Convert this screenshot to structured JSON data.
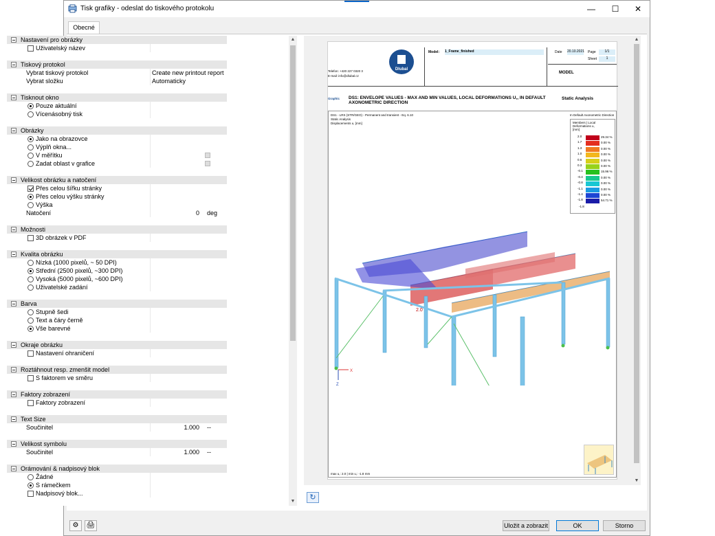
{
  "window": {
    "title": "Tisk grafiky - odeslat do tiskového protokolu"
  },
  "tabs": [
    {
      "label": "Obecné"
    }
  ],
  "tree": {
    "image_settings": {
      "title": "Nastavení pro obrázky",
      "user_name": "Uživatelský název"
    },
    "print_protocol": {
      "title": "Tiskový protokol",
      "select_protocol": "Vybrat tiskový protokol",
      "select_protocol_value": "Create new printout report",
      "select_folder": "Vybrat složku",
      "select_folder_value": "Automaticky"
    },
    "print_window": {
      "title": "Tisknout okno",
      "current_only": "Pouze aktuální",
      "multiple": "Vícenásobný tisk"
    },
    "images": {
      "title": "Obrázky",
      "as_on_screen": "Jako na obrazovce",
      "window_fill": "Výplň okna...",
      "to_scale": "V měřítku",
      "define_area": "Zadat oblast v grafice"
    },
    "size_rotation": {
      "title": "Velikost obrázku a natočení",
      "full_width": "Přes celou šířku stránky",
      "full_height": "Přes celou výšku stránky",
      "height": "Výška",
      "rotation": "Natočení",
      "rotation_value": "0",
      "rotation_unit": "deg"
    },
    "options": {
      "title": "Možnosti",
      "pdf3d": "3D obrázek v PDF"
    },
    "quality": {
      "title": "Kvalita obrázku",
      "low": "Nízká (1000 pixelů, ~ 50 DPI)",
      "medium": "Střední (2500 pixelů, ~300 DPI)",
      "high": "Vysoká (5000 pixelů, ~600 DPI)",
      "user": "Uživatelské zadání"
    },
    "color": {
      "title": "Barva",
      "grayscale": "Stupně šedi",
      "black_text": "Text a čáry černě",
      "all_color": "Vše barevné"
    },
    "margins": {
      "title": "Okraje obrázku",
      "set_margins": "Nastavení ohraničení"
    },
    "stretch": {
      "title": "Roztáhnout resp. zmenšit model",
      "with_factor": "S faktorem ve směru"
    },
    "display_factors": {
      "title": "Faktory zobrazení",
      "factors": "Faktory zobrazení"
    },
    "text_size": {
      "title": "Text Size",
      "factor": "Součinitel",
      "value": "1.000",
      "unit": "--"
    },
    "symbol_size": {
      "title": "Velikost symbolu",
      "factor": "Součinitel",
      "value": "1.000",
      "unit": "--"
    },
    "frame": {
      "title": "Orámování & nadpisový blok",
      "none": "Žádné",
      "with_frame": "S rámečkem",
      "title_block": "Nadpisový blok..."
    }
  },
  "preview": {
    "logo_text": "Dlubal",
    "model_label": "Model:",
    "model_value": "1_Frame_finished",
    "date_label": "Date",
    "date_value": "20.10.2021",
    "page_label": "Page",
    "page_value": "1/1",
    "sheet_label": "Sheet",
    "sheet_value": "1",
    "model_tag": "MODEL",
    "phone": "Telefon: +420 227 0320 3",
    "email": "E-mail: info@dlubal.cz",
    "graphic_label": "Graphic",
    "heading": "DS1: ENVELOPE VALUES - MAX AND MIN VALUES, LOCAL DEFORMATIONS U,, IN DEFAULT AXONOMETRIC DIRECTION",
    "right_heading": "Static Analysis",
    "sub1": "DS1 - LRS (STR/GEO) - Permanent and transient - Eq. 6.10",
    "sub2": "Static Analysis",
    "sub3": "Displacements u, [mm]",
    "view_dir": "In Default Axonometric Direction",
    "legend_title": "Members | Local Deformations u, [mm]",
    "legend": [
      {
        "v": "2.0",
        "p": "29.34 %",
        "c": "#c0001a"
      },
      {
        "v": "1.7",
        "p": "0.00 %",
        "c": "#e42d1f"
      },
      {
        "v": "1.3",
        "p": "0.00 %",
        "c": "#f07a21"
      },
      {
        "v": "1.0",
        "p": "0.00 %",
        "c": "#f3b71d"
      },
      {
        "v": "0.6",
        "p": "0.00 %",
        "c": "#d7cf19"
      },
      {
        "v": "0.3",
        "p": "0.00 %",
        "c": "#97d21a"
      },
      {
        "v": "-0.1",
        "p": "15.96 %",
        "c": "#27c11e"
      },
      {
        "v": "-0.4",
        "p": "0.00 %",
        "c": "#18c98f"
      },
      {
        "v": "-0.8",
        "p": "0.00 %",
        "c": "#19c7d3"
      },
      {
        "v": "-1.1",
        "p": "0.00 %",
        "c": "#1b9be2"
      },
      {
        "v": "-1.4",
        "p": "0.00 %",
        "c": "#1d45d4"
      },
      {
        "v": "-1.8",
        "p": "54.71 %",
        "c": "#1a1ca8"
      }
    ],
    "legend_bottom": "-1.8",
    "label_2": "2.0",
    "axis_x": "X",
    "axis_z": "Z",
    "footer": "max u,: 2.0 | min u,: -1.8 mm"
  },
  "buttons": {
    "save_show": "Uložit a zobrazit",
    "ok": "OK",
    "cancel": "Storno"
  }
}
